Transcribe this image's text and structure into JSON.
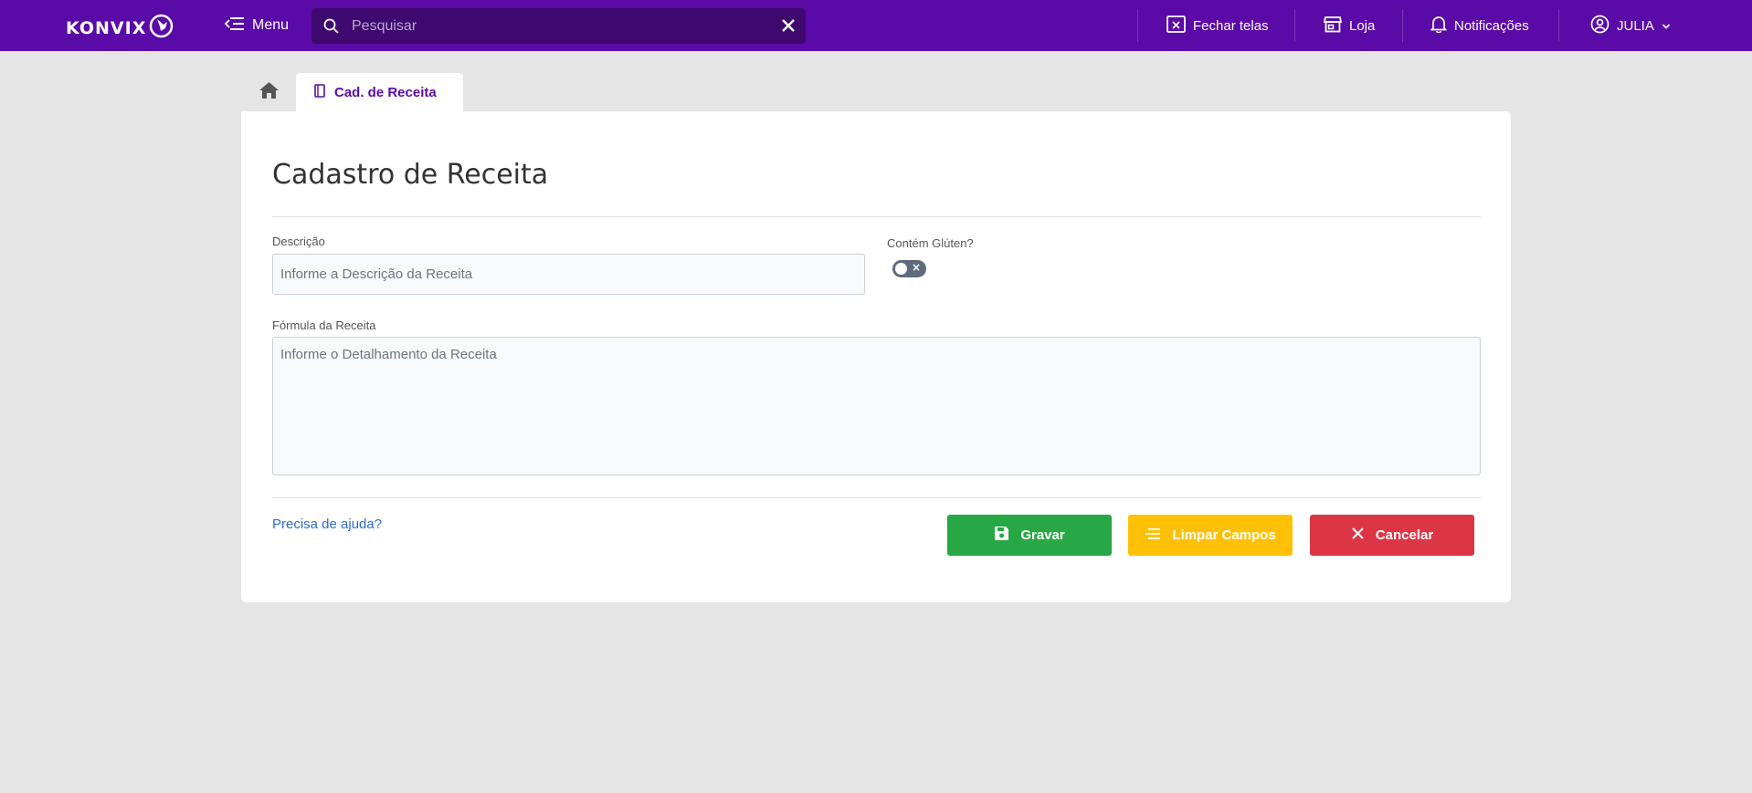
{
  "header": {
    "logo_text": "KONVIX",
    "menu_label": "Menu",
    "search_placeholder": "Pesquisar",
    "close_screens_label": "Fechar telas",
    "store_label": "Loja",
    "notifications_label": "Notificações",
    "user_name": "JULIA"
  },
  "tabs": [
    {
      "label": "Cad. de Receita",
      "active": true
    }
  ],
  "form": {
    "title": "Cadastro de Receita",
    "description_label": "Descrição",
    "description_placeholder": "Informe a Descrição da Receita",
    "gluten_label": "Contém Glúten?",
    "gluten_value": false,
    "formula_label": "Fórmula da Receita",
    "formula_placeholder": "Informe o Detalhamento da Receita",
    "help_link": "Precisa de ajuda?"
  },
  "actions": {
    "save_label": "Gravar",
    "clear_label": "Limpar Campos",
    "cancel_label": "Cancelar"
  },
  "colors": {
    "brand": "#5a0aa6",
    "save": "#28a745",
    "clear": "#ffc107",
    "cancel": "#dc3545"
  }
}
